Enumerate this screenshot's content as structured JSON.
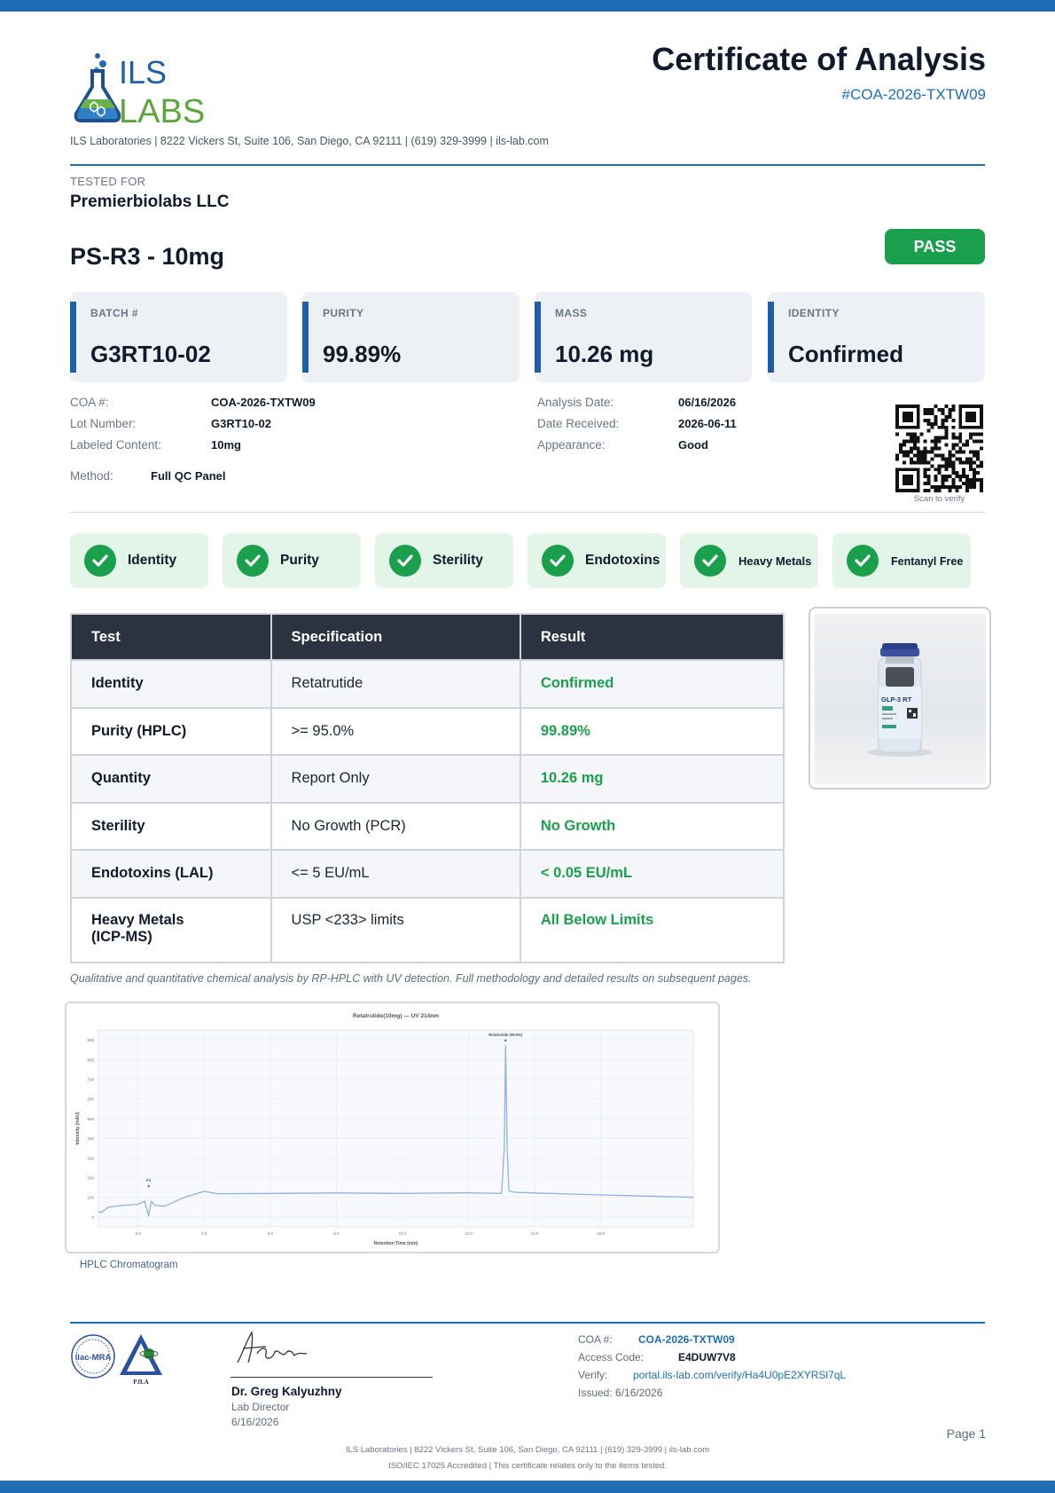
{
  "header": {
    "logo_text_top": "ILS",
    "logo_text_bottom": "LABS",
    "title": "Certificate of Analysis",
    "coa_id": "#COA-2026-TXTW09",
    "contact_line": "ILS Laboratories  |  8222 Vickers St, Suite 106, San Diego, CA 92111  |  (619) 329-3999  |  ils-lab.com"
  },
  "tested_for": {
    "label": "TESTED FOR",
    "name": "Premierbiolabs LLC"
  },
  "product": {
    "name": "PS-R3 - 10mg",
    "status": "PASS"
  },
  "cards": [
    {
      "label": "BATCH #",
      "value": "G3RT10-02"
    },
    {
      "label": "PURITY",
      "value": "99.89%"
    },
    {
      "label": "MASS",
      "value": "10.26 mg"
    },
    {
      "label": "IDENTITY",
      "value": "Confirmed"
    }
  ],
  "info": {
    "coa_label": "COA #:",
    "coa_value": "COA-2026-TXTW09",
    "lot_label": "Lot Number:",
    "lot_value": "G3RT10-02",
    "content_label": "Labeled Content:",
    "content_value": "10mg",
    "method_label": "Method:",
    "method_value": "Full QC Panel",
    "analysis_label": "Analysis Date:",
    "analysis_value": "06/16/2026",
    "received_label": "Date Received:",
    "received_value": "2026-06-11",
    "appearance_label": "Appearance:",
    "appearance_value": "Good",
    "qr_caption": "Scan to verify"
  },
  "checks": [
    "Identity",
    "Purity",
    "Sterility",
    "Endotoxins",
    "Heavy Metals",
    "Fentanyl Free"
  ],
  "table": {
    "headers": [
      "Test",
      "Specification",
      "Result"
    ],
    "rows": [
      {
        "test": "Identity",
        "spec": "Retatrutide",
        "result": "Confirmed"
      },
      {
        "test": "Purity (HPLC)",
        "spec": ">= 95.0%",
        "result": "99.89%"
      },
      {
        "test": "Quantity",
        "spec": "Report Only",
        "result": "10.26 mg"
      },
      {
        "test": "Sterility",
        "spec": "No Growth (PCR)",
        "result": "No Growth"
      },
      {
        "test": "Endotoxins (LAL)",
        "spec": "<= 5 EU/mL",
        "result": "< 0.05 EU/mL"
      },
      {
        "test": "Heavy Metals (ICP-MS)",
        "spec": "USP <233> limits",
        "result": "All Below Limits"
      }
    ]
  },
  "vial_label": "GLP-3 RT",
  "method_note": "Qualitative and quantitative chemical analysis by RP-HPLC with UV detection. Full methodology and detailed results on subsequent pages.",
  "chart_data": {
    "type": "line",
    "title": "Retatrutide(10mg) — UV 214nm",
    "xlabel": "Retention Time (min)",
    "ylabel": "Intensity (mAU)",
    "xlim": [
      0.8,
      18.8
    ],
    "ylim": [
      -50,
      950
    ],
    "xticks": [
      2.0,
      4.0,
      6.0,
      8.0,
      10.0,
      12.0,
      14.0,
      16.0
    ],
    "yticks": [
      0,
      100,
      200,
      300,
      400,
      500,
      600,
      700,
      800,
      900
    ],
    "grid": true,
    "series": [
      {
        "x": [
          0.8,
          0.9,
          1.1,
          1.5,
          2.0,
          2.2,
          2.32,
          2.4,
          2.5,
          2.8,
          3.4,
          4.0,
          4.4,
          6.0,
          8.0,
          10.0,
          12.0,
          13.0,
          13.08,
          13.12,
          13.17,
          13.22,
          13.3,
          13.5,
          14.0,
          16.0,
          18.8
        ],
        "y": [
          25,
          25,
          50,
          58,
          65,
          80,
          5,
          80,
          60,
          55,
          100,
          130,
          118,
          120,
          122,
          120,
          123,
          120,
          350,
          870,
          350,
          135,
          128,
          125,
          122,
          112,
          100
        ]
      }
    ],
    "annotations": [
      {
        "x": 2.32,
        "label": "P1"
      },
      {
        "x": 13.12,
        "label": "Retatrutide (99.9%)"
      }
    ],
    "caption": "HPLC Chromatogram"
  },
  "footer": {
    "signer_name": "Dr. Greg Kalyuzhny",
    "signer_role": "Lab Director",
    "signer_date": "6/16/2026",
    "coa_label": "COA #:",
    "coa_value": "COA-2026-TXTW09",
    "access_label": "Access Code:",
    "access_value": "E4DUW7V8",
    "verify_label": "Verify:",
    "verify_value": "portal.ils-lab.com/verify/Ha4U0pE2XYRSl7qL",
    "issued": "Issued: 6/16/2026",
    "page": "Page 1",
    "line1": "ILS Laboratories  |  8222 Vickers St, Suite 106, San Diego, CA 92111  |  (619) 329-3999  |  ils-lab.com",
    "line2": "ISO/IEC 17025 Accredited  |  This certificate relates only to the items tested.",
    "seal_left": "ilac-MRA",
    "seal_right": "PJLA"
  },
  "colors": {
    "brand_blue": "#1f6db5",
    "pass_green": "#1aa04c",
    "header_dark": "#2c3340"
  }
}
